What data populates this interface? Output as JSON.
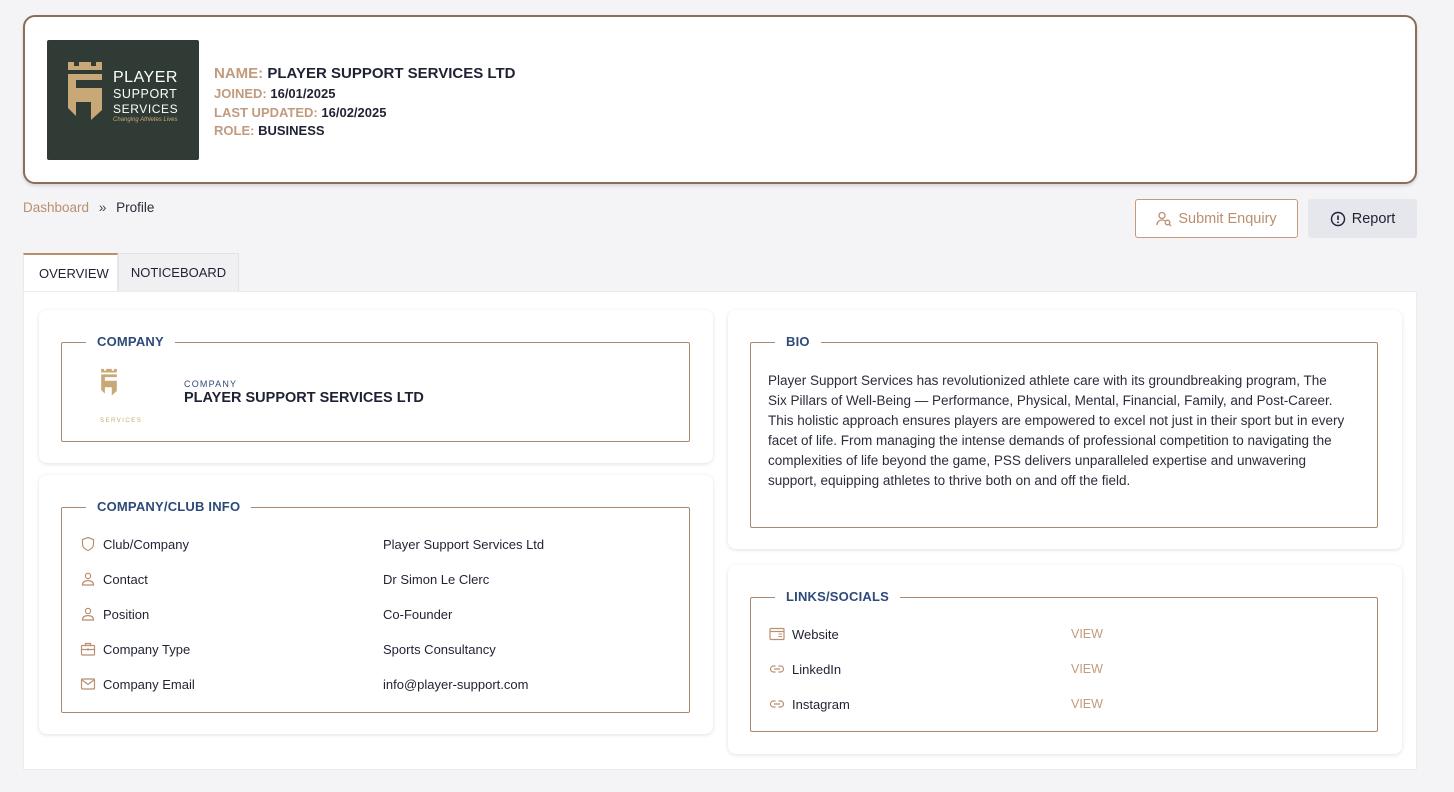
{
  "header": {
    "logo": {
      "line1": "PLAYER",
      "line2": "SUPPORT",
      "line3": "SERVICES",
      "tagline": "Changing Athletes Lives"
    },
    "name_label": "NAME:",
    "name_value": "PLAYER SUPPORT SERVICES LTD",
    "joined_label": "JOINED:",
    "joined_value": "16/01/2025",
    "updated_label": "LAST UPDATED:",
    "updated_value": "16/02/2025",
    "role_label": "ROLE:",
    "role_value": "BUSINESS"
  },
  "breadcrumb": {
    "home": "Dashboard",
    "sep": "»",
    "current": "Profile"
  },
  "actions": {
    "enquiry": "Submit Enquiry",
    "report": "Report"
  },
  "tabs": [
    {
      "label": "OVERVIEW"
    },
    {
      "label": "NOTICEBOARD"
    }
  ],
  "company": {
    "legend": "COMPANY",
    "logo_caption": "SERVICES",
    "sub_label": "COMPANY",
    "name": "PLAYER SUPPORT SERVICES LTD"
  },
  "company_info": {
    "legend": "COMPANY/CLUB INFO",
    "rows": [
      {
        "label": "Club/Company",
        "value": "Player Support Services Ltd",
        "icon": "shield-icon"
      },
      {
        "label": "Contact",
        "value": "Dr Simon Le Clerc",
        "icon": "person-icon"
      },
      {
        "label": "Position",
        "value": "Co-Founder",
        "icon": "person-icon"
      },
      {
        "label": "Company Type",
        "value": "Sports Consultancy",
        "icon": "briefcase-icon"
      },
      {
        "label": "Company Email",
        "value": "info@player-support.com",
        "icon": "mail-icon"
      }
    ]
  },
  "bio": {
    "legend": "BIO",
    "text": "Player Support Services has revolutionized athlete care with its groundbreaking program, The Six Pillars of Well-Being — Performance, Physical, Mental, Financial, Family, and Post-Career. This holistic approach ensures players are empowered to excel not just in their sport but in every facet of life. From managing the intense demands of professional competition to navigating the complexities of life beyond the game, PSS delivers unparalleled expertise and unwavering support, equipping athletes to thrive both on and off the field."
  },
  "links": {
    "legend": "LINKS/SOCIALS",
    "rows": [
      {
        "label": "Website",
        "action": "VIEW",
        "icon": "browser-icon"
      },
      {
        "label": "LinkedIn",
        "action": "VIEW",
        "icon": "link-icon"
      },
      {
        "label": "Instagram",
        "action": "VIEW",
        "icon": "link-icon"
      }
    ]
  },
  "colors": {
    "accent": "#b98f6f",
    "legend": "#2d4a7a",
    "logo_bg": "#2f3b34"
  }
}
